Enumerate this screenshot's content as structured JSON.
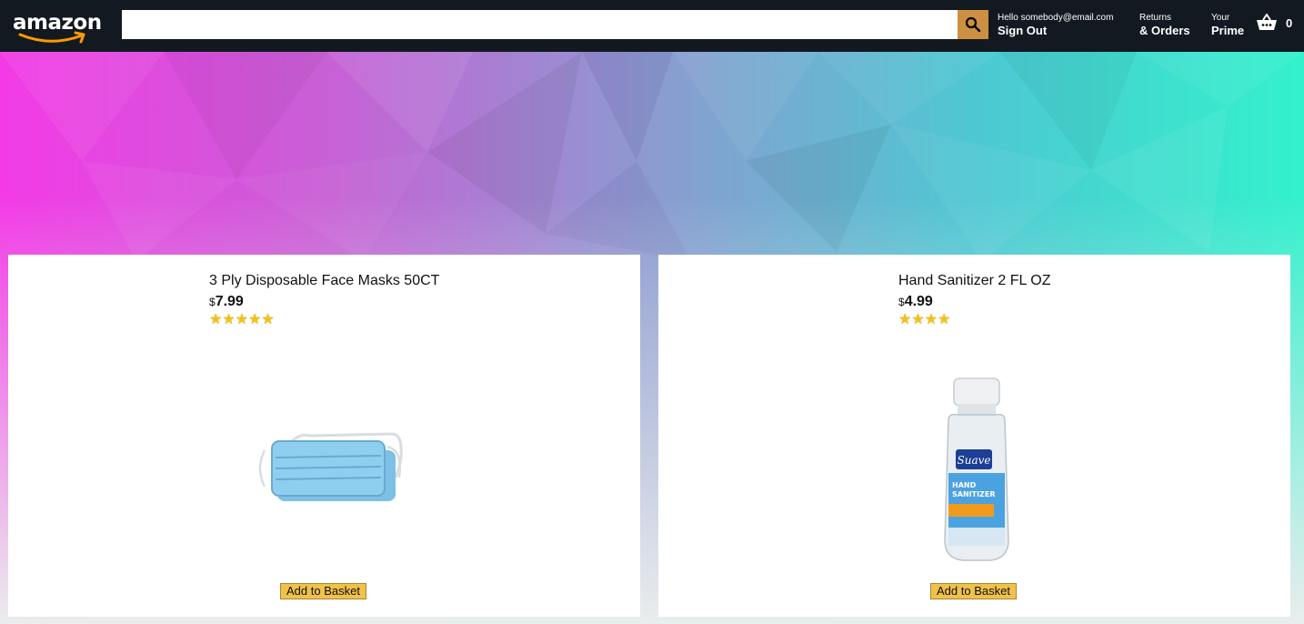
{
  "header": {
    "logo_text": "amazon",
    "search": {
      "value": "",
      "placeholder": ""
    },
    "user": {
      "line_one": "Hello somebody@email.com",
      "line_two": "Sign Out"
    },
    "returns": {
      "line_one": "Returns",
      "line_two": "& Orders"
    },
    "prime": {
      "line_one": "Your",
      "line_two": "Prime"
    },
    "basket_count": "0"
  },
  "colors": {
    "header_bg": "#131921",
    "search_button": "#cd9042",
    "add_button": "#f0c14b",
    "star": "#f3c21a"
  },
  "products": [
    {
      "title": "3 Ply Disposable Face Masks 50CT",
      "currency": "$",
      "price": "7.99",
      "rating": 5,
      "stars_text": "★★★★★",
      "image_icon": "face-mask-image",
      "button_label": "Add to Basket"
    },
    {
      "title": "Hand Sanitizer 2 FL OZ",
      "currency": "$",
      "price": "4.99",
      "rating": 4,
      "stars_text": "★★★★",
      "image_icon": "hand-sanitizer-image",
      "button_label": "Add to Basket"
    }
  ]
}
